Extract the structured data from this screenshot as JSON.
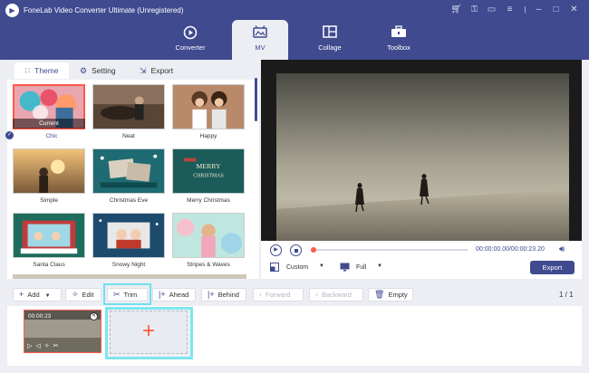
{
  "app": {
    "title": "FoneLab Video Converter Ultimate (Unregistered)"
  },
  "window_icons": [
    "cart-icon",
    "key-icon",
    "chat-icon",
    "menu-icon",
    "minimize-icon",
    "maximize-icon",
    "close-icon"
  ],
  "nav": [
    {
      "label": "Converter",
      "icon": "converter-icon"
    },
    {
      "label": "MV",
      "icon": "mv-icon",
      "active": true
    },
    {
      "label": "Collage",
      "icon": "collage-icon"
    },
    {
      "label": "Toolbox",
      "icon": "toolbox-icon"
    }
  ],
  "tabs": [
    {
      "label": "Theme",
      "icon": "grid-icon",
      "active": true
    },
    {
      "label": "Setting",
      "icon": "gear-icon"
    },
    {
      "label": "Export",
      "icon": "export-icon"
    }
  ],
  "themes": [
    {
      "label": "Chic",
      "selected": true,
      "badge": "Current"
    },
    {
      "label": "Neat"
    },
    {
      "label": "Happy"
    },
    {
      "label": "Simple"
    },
    {
      "label": "Christmas Eve"
    },
    {
      "label": "Merry Christmas"
    },
    {
      "label": "Santa Claus"
    },
    {
      "label": "Snowy Night"
    },
    {
      "label": "Stripes & Waves"
    }
  ],
  "player": {
    "time": "00:00:00.00/00:00:23.20",
    "aspect": "Custom",
    "zoom": "Full",
    "export_label": "Export",
    "progress": 0
  },
  "toolbar": {
    "add": "Add",
    "edit": "Edit",
    "trim": "Trim",
    "ahead": "Ahead",
    "behind": "Behind",
    "forward": "Forward",
    "backward": "Backward",
    "empty": "Empty",
    "page_current": "1",
    "page_total": "1"
  },
  "timeline": {
    "clip_time": "00:00:23",
    "add_symbol": "+"
  },
  "colors": {
    "accent": "#3f4a8f",
    "highlight": "#6fe0ee",
    "selection": "#ff5a4a"
  }
}
